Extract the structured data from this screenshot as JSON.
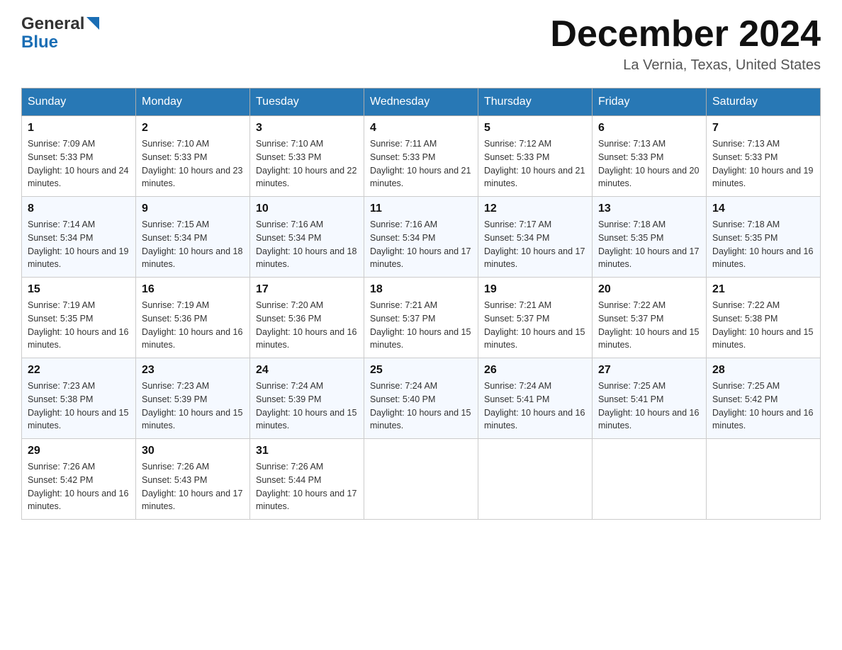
{
  "header": {
    "logo_general": "General",
    "logo_blue": "Blue",
    "month_title": "December 2024",
    "location": "La Vernia, Texas, United States"
  },
  "days_of_week": [
    "Sunday",
    "Monday",
    "Tuesday",
    "Wednesday",
    "Thursday",
    "Friday",
    "Saturday"
  ],
  "weeks": [
    [
      {
        "day": "1",
        "sunrise": "7:09 AM",
        "sunset": "5:33 PM",
        "daylight": "10 hours and 24 minutes."
      },
      {
        "day": "2",
        "sunrise": "7:10 AM",
        "sunset": "5:33 PM",
        "daylight": "10 hours and 23 minutes."
      },
      {
        "day": "3",
        "sunrise": "7:10 AM",
        "sunset": "5:33 PM",
        "daylight": "10 hours and 22 minutes."
      },
      {
        "day": "4",
        "sunrise": "7:11 AM",
        "sunset": "5:33 PM",
        "daylight": "10 hours and 21 minutes."
      },
      {
        "day": "5",
        "sunrise": "7:12 AM",
        "sunset": "5:33 PM",
        "daylight": "10 hours and 21 minutes."
      },
      {
        "day": "6",
        "sunrise": "7:13 AM",
        "sunset": "5:33 PM",
        "daylight": "10 hours and 20 minutes."
      },
      {
        "day": "7",
        "sunrise": "7:13 AM",
        "sunset": "5:33 PM",
        "daylight": "10 hours and 19 minutes."
      }
    ],
    [
      {
        "day": "8",
        "sunrise": "7:14 AM",
        "sunset": "5:34 PM",
        "daylight": "10 hours and 19 minutes."
      },
      {
        "day": "9",
        "sunrise": "7:15 AM",
        "sunset": "5:34 PM",
        "daylight": "10 hours and 18 minutes."
      },
      {
        "day": "10",
        "sunrise": "7:16 AM",
        "sunset": "5:34 PM",
        "daylight": "10 hours and 18 minutes."
      },
      {
        "day": "11",
        "sunrise": "7:16 AM",
        "sunset": "5:34 PM",
        "daylight": "10 hours and 17 minutes."
      },
      {
        "day": "12",
        "sunrise": "7:17 AM",
        "sunset": "5:34 PM",
        "daylight": "10 hours and 17 minutes."
      },
      {
        "day": "13",
        "sunrise": "7:18 AM",
        "sunset": "5:35 PM",
        "daylight": "10 hours and 17 minutes."
      },
      {
        "day": "14",
        "sunrise": "7:18 AM",
        "sunset": "5:35 PM",
        "daylight": "10 hours and 16 minutes."
      }
    ],
    [
      {
        "day": "15",
        "sunrise": "7:19 AM",
        "sunset": "5:35 PM",
        "daylight": "10 hours and 16 minutes."
      },
      {
        "day": "16",
        "sunrise": "7:19 AM",
        "sunset": "5:36 PM",
        "daylight": "10 hours and 16 minutes."
      },
      {
        "day": "17",
        "sunrise": "7:20 AM",
        "sunset": "5:36 PM",
        "daylight": "10 hours and 16 minutes."
      },
      {
        "day": "18",
        "sunrise": "7:21 AM",
        "sunset": "5:37 PM",
        "daylight": "10 hours and 15 minutes."
      },
      {
        "day": "19",
        "sunrise": "7:21 AM",
        "sunset": "5:37 PM",
        "daylight": "10 hours and 15 minutes."
      },
      {
        "day": "20",
        "sunrise": "7:22 AM",
        "sunset": "5:37 PM",
        "daylight": "10 hours and 15 minutes."
      },
      {
        "day": "21",
        "sunrise": "7:22 AM",
        "sunset": "5:38 PM",
        "daylight": "10 hours and 15 minutes."
      }
    ],
    [
      {
        "day": "22",
        "sunrise": "7:23 AM",
        "sunset": "5:38 PM",
        "daylight": "10 hours and 15 minutes."
      },
      {
        "day": "23",
        "sunrise": "7:23 AM",
        "sunset": "5:39 PM",
        "daylight": "10 hours and 15 minutes."
      },
      {
        "day": "24",
        "sunrise": "7:24 AM",
        "sunset": "5:39 PM",
        "daylight": "10 hours and 15 minutes."
      },
      {
        "day": "25",
        "sunrise": "7:24 AM",
        "sunset": "5:40 PM",
        "daylight": "10 hours and 15 minutes."
      },
      {
        "day": "26",
        "sunrise": "7:24 AM",
        "sunset": "5:41 PM",
        "daylight": "10 hours and 16 minutes."
      },
      {
        "day": "27",
        "sunrise": "7:25 AM",
        "sunset": "5:41 PM",
        "daylight": "10 hours and 16 minutes."
      },
      {
        "day": "28",
        "sunrise": "7:25 AM",
        "sunset": "5:42 PM",
        "daylight": "10 hours and 16 minutes."
      }
    ],
    [
      {
        "day": "29",
        "sunrise": "7:26 AM",
        "sunset": "5:42 PM",
        "daylight": "10 hours and 16 minutes."
      },
      {
        "day": "30",
        "sunrise": "7:26 AM",
        "sunset": "5:43 PM",
        "daylight": "10 hours and 17 minutes."
      },
      {
        "day": "31",
        "sunrise": "7:26 AM",
        "sunset": "5:44 PM",
        "daylight": "10 hours and 17 minutes."
      },
      null,
      null,
      null,
      null
    ]
  ],
  "labels": {
    "sunrise_prefix": "Sunrise: ",
    "sunset_prefix": "Sunset: ",
    "daylight_prefix": "Daylight: "
  }
}
